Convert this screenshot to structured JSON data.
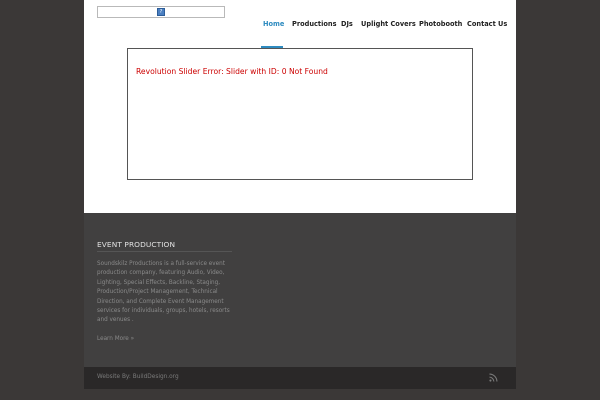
{
  "logo": {
    "icon": "broken-image-icon",
    "glyph": "?"
  },
  "nav": {
    "items": [
      {
        "label": "Home",
        "active": true
      },
      {
        "label": "Productions"
      },
      {
        "label": "DJs"
      },
      {
        "label": "Uplight Covers"
      },
      {
        "label": "Photobooth"
      },
      {
        "label": "Contact Us"
      }
    ],
    "accent_color": "#2e8bc0"
  },
  "slider": {
    "error_text": "Revolution Slider Error: Slider with ID: 0 Not Found",
    "error_color": "#cc0000"
  },
  "widget": {
    "title": "EVENT PRODUCTION",
    "text": "Soundskilz Productions is a full-service event production company, featuring Audio, Video, Lighting, Special Effects, Backline, Staging, Production/Project Management, Technical Direction, and Complete Event Management services for individuals, groups, hotels, resorts and venues .",
    "link": "Learn More »"
  },
  "footer": {
    "credit": "Website By: BuildDesign.org",
    "icon": "rss-icon"
  }
}
